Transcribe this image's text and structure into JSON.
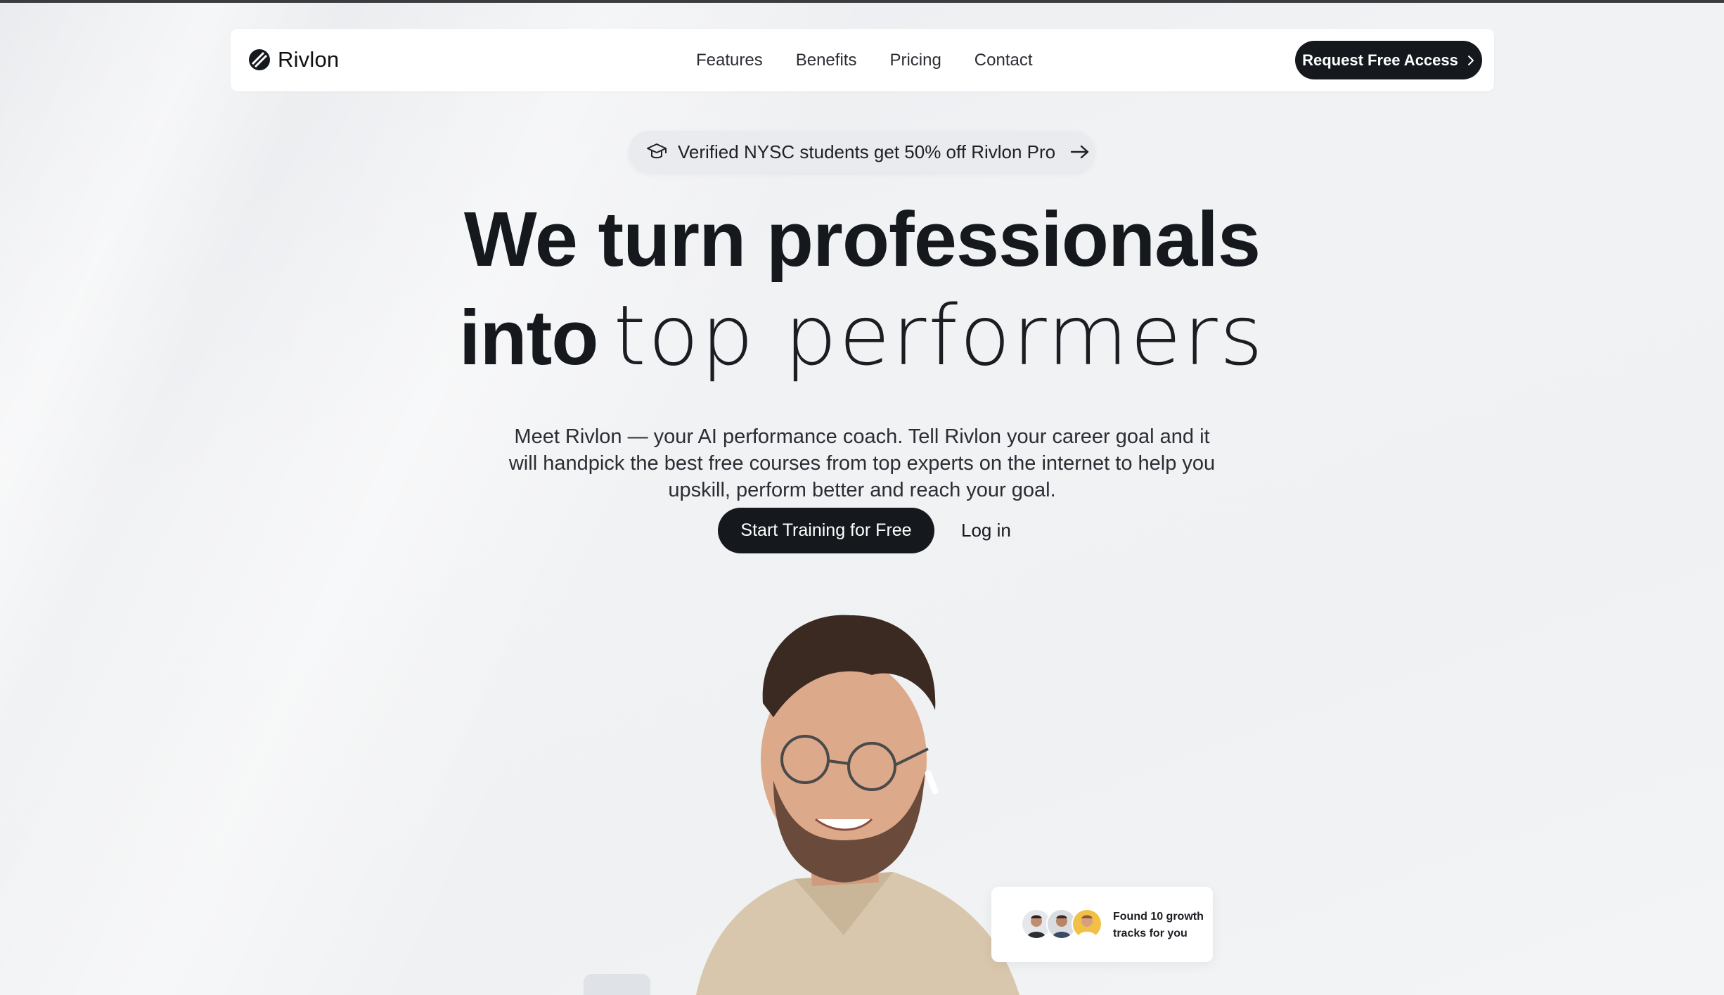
{
  "nav": {
    "brand": "Rivlon",
    "links": [
      "Features",
      "Benefits",
      "Pricing",
      "Contact"
    ],
    "cta_label": "Request Free Access"
  },
  "promo": {
    "text": "Verified NYSC students get 50% off Rivlon Pro",
    "icon": "graduation-cap-icon"
  },
  "hero": {
    "headline_line1": "We turn professionals",
    "headline_line2_bold": "into",
    "headline_line2_light": "top performers",
    "description": "Meet Rivlon — your AI performance coach. Tell Rivlon your career goal and it will handpick the best free courses from top experts on the internet to help you upskill, perform better and reach your goal.",
    "primary_cta": "Start Training for Free",
    "secondary_cta": "Log in"
  },
  "float_card": {
    "text": "Found 10 growth tracks for you"
  },
  "colors": {
    "primary": "#15191e",
    "background": "#eef0f2",
    "surface": "#ffffff"
  }
}
